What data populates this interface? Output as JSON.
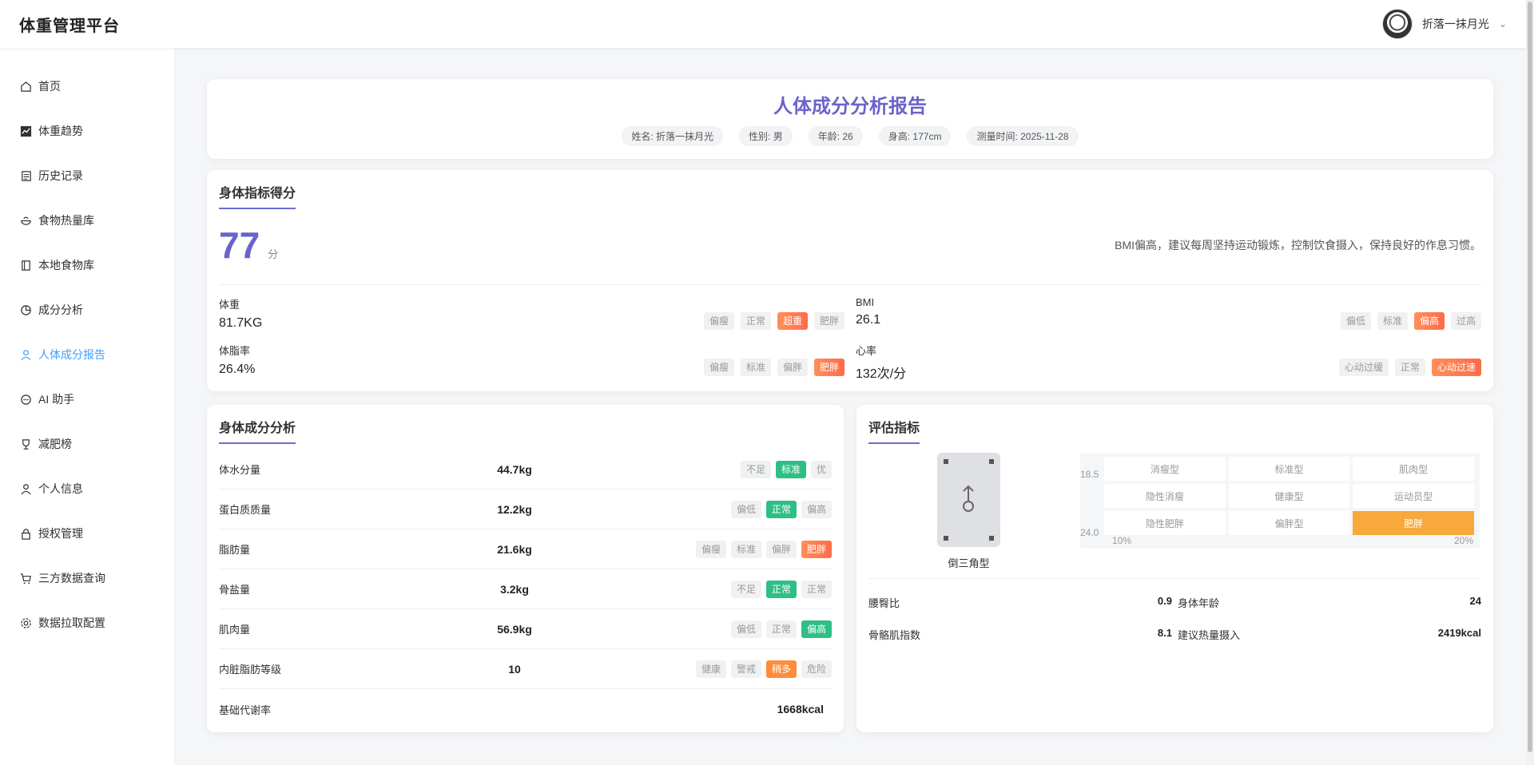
{
  "header": {
    "brand": "体重管理平台",
    "username": "折落一抹月光"
  },
  "sidebar": {
    "items": [
      {
        "label": "首页",
        "icon": "home-icon"
      },
      {
        "label": "体重趋势",
        "icon": "trend-chart-icon"
      },
      {
        "label": "历史记录",
        "icon": "document-icon"
      },
      {
        "label": "食物热量库",
        "icon": "bowl-icon"
      },
      {
        "label": "本地食物库",
        "icon": "book-icon"
      },
      {
        "label": "成分分析",
        "icon": "pie-chart-icon"
      },
      {
        "label": "人体成分报告",
        "icon": "user-icon",
        "active": true
      },
      {
        "label": "AI 助手",
        "icon": "chat-icon"
      },
      {
        "label": "减肥榜",
        "icon": "trophy-icon"
      },
      {
        "label": "个人信息",
        "icon": "user-icon"
      },
      {
        "label": "授权管理",
        "icon": "lock-icon"
      },
      {
        "label": "三方数据查询",
        "icon": "cart-icon"
      },
      {
        "label": "数据拉取配置",
        "icon": "gear-icon"
      }
    ]
  },
  "report": {
    "title": "人体成分分析报告",
    "pills": [
      "姓名: 折落一抹月光",
      "性别: 男",
      "年龄: 26",
      "身高: 177cm",
      "测量时间: 2025-11-28"
    ]
  },
  "score": {
    "title": "身体指标得分",
    "value": "77",
    "unit": "分",
    "advice": "BMI偏高，建议每周坚持运动锻炼，控制饮食摄入，保持良好的作息习惯。",
    "metrics": [
      {
        "label": "体重",
        "value": "81.7KG",
        "tags": [
          "偏瘦",
          "正常",
          "超重",
          "肥胖"
        ],
        "active": 2
      },
      {
        "label": "BMI",
        "value": "26.1",
        "tags": [
          "偏低",
          "标准",
          "偏高",
          "过高"
        ],
        "active": 2
      },
      {
        "label": "体脂率",
        "value": "26.4%",
        "tags": [
          "偏瘦",
          "标准",
          "偏胖",
          "肥胖"
        ],
        "active": 3
      },
      {
        "label": "心率",
        "value": "132次/分",
        "tags": [
          "心动过缓",
          "正常",
          "心动过速"
        ],
        "active": 2
      }
    ]
  },
  "composition": {
    "title": "身体成分分析",
    "rows": [
      {
        "name": "体水分量",
        "value": "44.7kg",
        "tags": [
          "不足",
          "标准",
          "优"
        ],
        "active": 1,
        "color": "green"
      },
      {
        "name": "蛋白质质量",
        "value": "12.2kg",
        "tags": [
          "偏低",
          "正常",
          "偏高"
        ],
        "active": 1,
        "color": "green"
      },
      {
        "name": "脂肪量",
        "value": "21.6kg",
        "tags": [
          "偏瘦",
          "标准",
          "偏胖",
          "肥胖"
        ],
        "active": 3,
        "color": "orange"
      },
      {
        "name": "骨盐量",
        "value": "3.2kg",
        "tags": [
          "不足",
          "正常",
          "正常"
        ],
        "active": 1,
        "color": "green"
      },
      {
        "name": "肌肉量",
        "value": "56.9kg",
        "tags": [
          "偏低",
          "正常",
          "偏高"
        ],
        "active": 2,
        "color": "green"
      },
      {
        "name": "内脏脂肪等级",
        "value": "10",
        "tags": [
          "健康",
          "警戒",
          "稍多",
          "危险"
        ],
        "active": 2,
        "color": "amber"
      },
      {
        "name": "基础代谢率",
        "value": "1668kcal",
        "tags": [],
        "active": -1,
        "color": ""
      }
    ]
  },
  "evaluation": {
    "title": "评估指标",
    "body_shape": "倒三角型",
    "grid": {
      "y_labels": [
        "18.5",
        "24.0"
      ],
      "x_labels": [
        "10%",
        "20%"
      ],
      "cells": [
        "消瘦型",
        "标准型",
        "肌肉型",
        "隐性消瘦",
        "健康型",
        "运动员型",
        "隐性肥胖",
        "偏胖型",
        "肥胖"
      ],
      "highlight": 8
    },
    "indicators": {
      "waist_hip_label": "腰臀比",
      "waist_hip_value": "0.9",
      "body_age_label": "身体年龄",
      "body_age_value": "24",
      "smi_label": "骨骼肌指数",
      "smi_value": "8.1",
      "calorie_label": "建议热量摄入",
      "calorie_value": "2419kcal"
    }
  }
}
